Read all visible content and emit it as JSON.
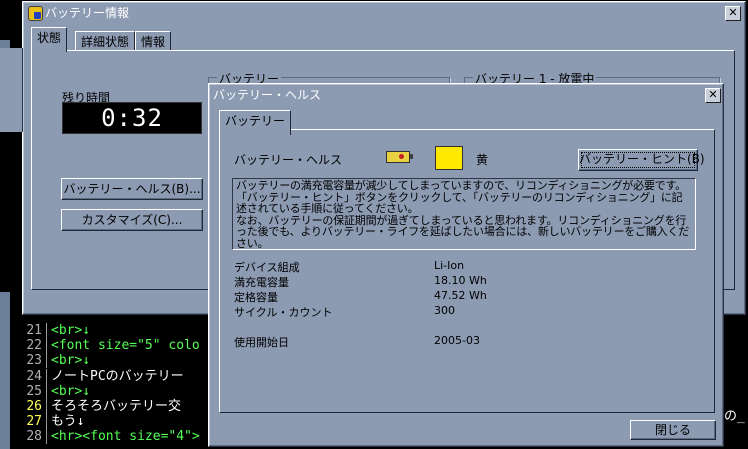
{
  "editor": {
    "lines": [
      {
        "num": "21",
        "text": "<br>↓",
        "tag": true
      },
      {
        "num": "22",
        "text": "<font size=\"5\" colo",
        "tag": true
      },
      {
        "num": "23",
        "text": "<br>↓",
        "tag": true
      },
      {
        "num": "24",
        "text": "ノートPCのバッテリー",
        "tag": false
      },
      {
        "num": "25",
        "text": "<br>↓",
        "tag": true
      },
      {
        "num": "26",
        "text": "そろそろバッテリー交",
        "tag": false,
        "hl": true
      },
      {
        "num": "27",
        "text": "もう↓",
        "tag": false,
        "hl": true
      },
      {
        "num": "28",
        "text": "<hr><font size=\"4\">",
        "tag": true
      }
    ],
    "right_fragment": "の_"
  },
  "main_window": {
    "title": "バッテリー情報",
    "tabs": [
      "状態",
      "詳細状態",
      "情報"
    ],
    "remaining_label": "残り時間",
    "remaining_time": "0:32",
    "group_battery": "バッテリー",
    "group_battery1": "バッテリー 1 - 放電中",
    "btn_health": "バッテリー・ヘルス(B)...",
    "btn_customize": "カスタマイズ(C)..."
  },
  "dialog": {
    "title": "バッテリー・ヘルス",
    "tab": "バッテリー",
    "health_label": "バッテリー・ヘルス",
    "health_status": "黄",
    "health_color": "#ffe800",
    "hint_button": "バッテリー・ヒント(B)",
    "message": [
      "バッテリーの満充電容量が減少してしまっていますので、リコンディショニングが必要です。",
      "「バッテリー・ヒント」ボタンをクリックして、「バッテリーのリコンディショニング」に記述されている手順に従ってください。",
      "なお、バッテリーの保証期間が過ぎてしまっていると思われます。リコンディショニングを行った後でも、よりバッテリー・ライフを延ばしたい場合には、新しいバッテリーをご購入ください。"
    ],
    "details": [
      {
        "label": "デバイス組成",
        "value": "Li-Ion"
      },
      {
        "label": "満充電容量",
        "value": "18.10 Wh"
      },
      {
        "label": "定格容量",
        "value": "47.52 Wh"
      },
      {
        "label": "サイクル・カウント",
        "value": "300"
      }
    ],
    "first_use_label": "使用開始日",
    "first_use_value": "2005-03",
    "close_button": "閉じる"
  }
}
